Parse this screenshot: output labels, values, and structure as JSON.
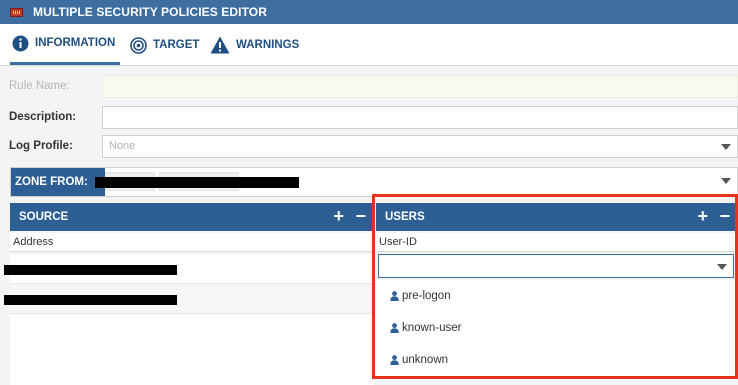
{
  "window": {
    "title": "MULTIPLE SECURITY POLICIES EDITOR"
  },
  "tabs": [
    {
      "label": "INFORMATION",
      "icon": "info-icon",
      "active": true
    },
    {
      "label": "TARGET",
      "icon": "target-icon",
      "active": false
    },
    {
      "label": "WARNINGS",
      "icon": "warning-icon",
      "active": false
    }
  ],
  "form": {
    "rule_name_label": "Rule Name:",
    "description_label": "Description:",
    "log_profile_label": "Log Profile:",
    "log_profile_value": "None"
  },
  "zone_from": {
    "label": "ZONE FROM:"
  },
  "source": {
    "title": "SOURCE",
    "column": "Address",
    "add_label": "+",
    "remove_label": "−"
  },
  "users": {
    "title": "USERS",
    "column": "User-ID",
    "add_label": "+",
    "remove_label": "−",
    "selected_value": "",
    "options": [
      "pre-logon",
      "known-user",
      "unknown"
    ]
  },
  "colors": {
    "titlebar": "#3e6da0",
    "header": "#2d5f94",
    "tab_text": "#1f4f82",
    "highlight": "#e8331c"
  }
}
